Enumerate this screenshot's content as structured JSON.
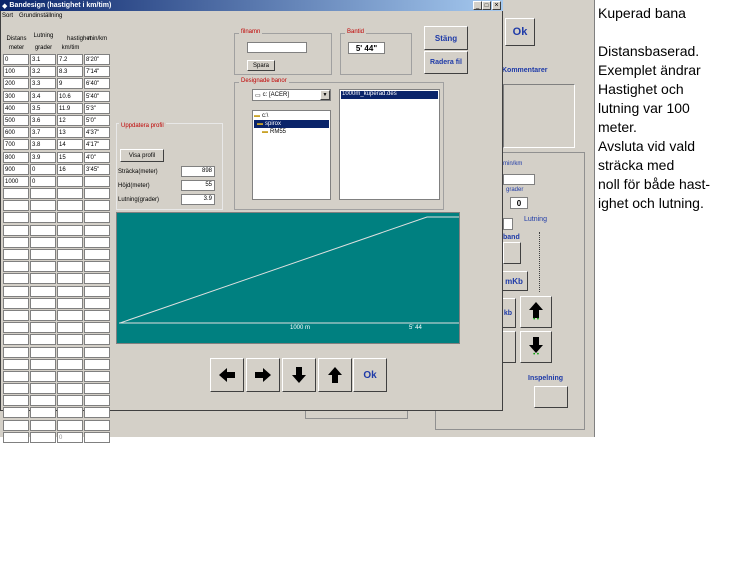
{
  "window": {
    "title": "Bandesign (hastighet i km/tim)",
    "menu": [
      "Sort",
      "Grundinställning"
    ],
    "controls": [
      "_",
      "□",
      "×"
    ]
  },
  "table": {
    "headers": [
      [
        "Distans",
        "meter"
      ],
      [
        "Lutning",
        "grader"
      ],
      [
        "hastighet",
        "km/tim"
      ],
      [
        "",
        "min/km"
      ]
    ],
    "rows": [
      [
        "0",
        "3.1",
        "7.2",
        "8'20\""
      ],
      [
        "100",
        "3.2",
        "8.3",
        "7'14\""
      ],
      [
        "200",
        "3.3",
        "9",
        "6'40\""
      ],
      [
        "300",
        "3.4",
        "10.6",
        "5'40\""
      ],
      [
        "400",
        "3.5",
        "11.9",
        "5'3\""
      ],
      [
        "500",
        "3.6",
        "12",
        "5'0\""
      ],
      [
        "600",
        "3.7",
        "13",
        "4'37\""
      ],
      [
        "700",
        "3.8",
        "14",
        "4'17\""
      ],
      [
        "800",
        "3.9",
        "15",
        "4'0\""
      ],
      [
        "900",
        "0",
        "16",
        "3'45\""
      ],
      [
        "1000",
        "0",
        "",
        ""
      ]
    ],
    "last_row_value": "0"
  },
  "filename": {
    "label": "filnamn",
    "value": "",
    "save_label": "Spara"
  },
  "bantid": {
    "label": "Bantid",
    "value": "5' 44\""
  },
  "buttons": {
    "close": "Stäng",
    "delete_file": "Radera fil",
    "ok": "Ok"
  },
  "designed": {
    "label": "Designade banor",
    "drive": "c: [ACER]",
    "folders": [
      "c:\\",
      "spirox",
      "RM55"
    ],
    "files": [
      "1000m_kuperad.des"
    ]
  },
  "update_profile": {
    "label": "Uppdatera profil",
    "show_label": "Visa profil",
    "distance_label": "Sträcka(meter)",
    "distance_value": "898",
    "height_label": "Höjd(meter)",
    "height_value": "55",
    "slope_label": "Lutning(grader)",
    "slope_value": "3.9"
  },
  "profile": {
    "distance_label": "1000 m",
    "time_label": "5' 44",
    "bg_color": "#008080"
  },
  "background_app": {
    "ok": "Ok",
    "comments_label": "Kommentarer",
    "minkm_label": "min/km",
    "grader_label": "grader",
    "grader_value": "0",
    "lutning_label": "Lutning",
    "band_label": "band",
    "mkb_label": "mKb",
    "kb_label": "kb",
    "inspelning_label": "Inspelning"
  },
  "note": {
    "title": "Kuperad bana",
    "lines": [
      "Distansbaserad.",
      "Exemplet ändrar",
      "Hastighet och",
      "lutning var 100",
      "meter.",
      "Avsluta vid vald",
      "sträcka med",
      "noll för både hast-",
      "ighet och lutning."
    ]
  },
  "colors": {
    "titlebar_start": "#0a246a",
    "titlebar_end": "#a6caf0",
    "accent_text": "#1e3aa8",
    "group_label": "#c00000"
  }
}
